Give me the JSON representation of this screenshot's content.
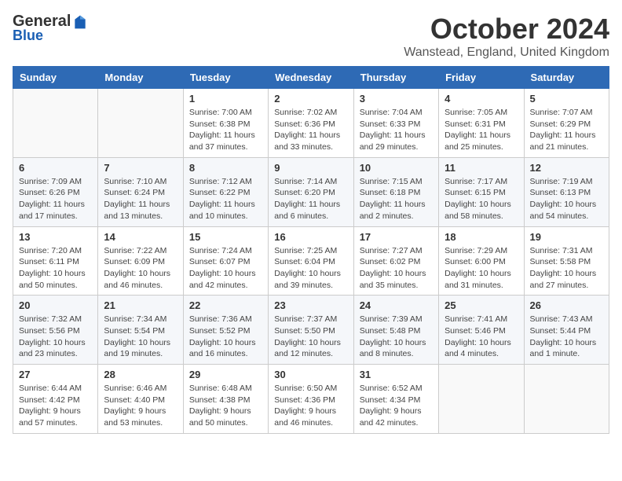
{
  "header": {
    "logo_general": "General",
    "logo_blue": "Blue",
    "month_title": "October 2024",
    "location": "Wanstead, England, United Kingdom"
  },
  "days_of_week": [
    "Sunday",
    "Monday",
    "Tuesday",
    "Wednesday",
    "Thursday",
    "Friday",
    "Saturday"
  ],
  "weeks": [
    [
      {
        "day": "",
        "info": ""
      },
      {
        "day": "",
        "info": ""
      },
      {
        "day": "1",
        "info": "Sunrise: 7:00 AM\nSunset: 6:38 PM\nDaylight: 11 hours\nand 37 minutes."
      },
      {
        "day": "2",
        "info": "Sunrise: 7:02 AM\nSunset: 6:36 PM\nDaylight: 11 hours\nand 33 minutes."
      },
      {
        "day": "3",
        "info": "Sunrise: 7:04 AM\nSunset: 6:33 PM\nDaylight: 11 hours\nand 29 minutes."
      },
      {
        "day": "4",
        "info": "Sunrise: 7:05 AM\nSunset: 6:31 PM\nDaylight: 11 hours\nand 25 minutes."
      },
      {
        "day": "5",
        "info": "Sunrise: 7:07 AM\nSunset: 6:29 PM\nDaylight: 11 hours\nand 21 minutes."
      }
    ],
    [
      {
        "day": "6",
        "info": "Sunrise: 7:09 AM\nSunset: 6:26 PM\nDaylight: 11 hours\nand 17 minutes."
      },
      {
        "day": "7",
        "info": "Sunrise: 7:10 AM\nSunset: 6:24 PM\nDaylight: 11 hours\nand 13 minutes."
      },
      {
        "day": "8",
        "info": "Sunrise: 7:12 AM\nSunset: 6:22 PM\nDaylight: 11 hours\nand 10 minutes."
      },
      {
        "day": "9",
        "info": "Sunrise: 7:14 AM\nSunset: 6:20 PM\nDaylight: 11 hours\nand 6 minutes."
      },
      {
        "day": "10",
        "info": "Sunrise: 7:15 AM\nSunset: 6:18 PM\nDaylight: 11 hours\nand 2 minutes."
      },
      {
        "day": "11",
        "info": "Sunrise: 7:17 AM\nSunset: 6:15 PM\nDaylight: 10 hours\nand 58 minutes."
      },
      {
        "day": "12",
        "info": "Sunrise: 7:19 AM\nSunset: 6:13 PM\nDaylight: 10 hours\nand 54 minutes."
      }
    ],
    [
      {
        "day": "13",
        "info": "Sunrise: 7:20 AM\nSunset: 6:11 PM\nDaylight: 10 hours\nand 50 minutes."
      },
      {
        "day": "14",
        "info": "Sunrise: 7:22 AM\nSunset: 6:09 PM\nDaylight: 10 hours\nand 46 minutes."
      },
      {
        "day": "15",
        "info": "Sunrise: 7:24 AM\nSunset: 6:07 PM\nDaylight: 10 hours\nand 42 minutes."
      },
      {
        "day": "16",
        "info": "Sunrise: 7:25 AM\nSunset: 6:04 PM\nDaylight: 10 hours\nand 39 minutes."
      },
      {
        "day": "17",
        "info": "Sunrise: 7:27 AM\nSunset: 6:02 PM\nDaylight: 10 hours\nand 35 minutes."
      },
      {
        "day": "18",
        "info": "Sunrise: 7:29 AM\nSunset: 6:00 PM\nDaylight: 10 hours\nand 31 minutes."
      },
      {
        "day": "19",
        "info": "Sunrise: 7:31 AM\nSunset: 5:58 PM\nDaylight: 10 hours\nand 27 minutes."
      }
    ],
    [
      {
        "day": "20",
        "info": "Sunrise: 7:32 AM\nSunset: 5:56 PM\nDaylight: 10 hours\nand 23 minutes."
      },
      {
        "day": "21",
        "info": "Sunrise: 7:34 AM\nSunset: 5:54 PM\nDaylight: 10 hours\nand 19 minutes."
      },
      {
        "day": "22",
        "info": "Sunrise: 7:36 AM\nSunset: 5:52 PM\nDaylight: 10 hours\nand 16 minutes."
      },
      {
        "day": "23",
        "info": "Sunrise: 7:37 AM\nSunset: 5:50 PM\nDaylight: 10 hours\nand 12 minutes."
      },
      {
        "day": "24",
        "info": "Sunrise: 7:39 AM\nSunset: 5:48 PM\nDaylight: 10 hours\nand 8 minutes."
      },
      {
        "day": "25",
        "info": "Sunrise: 7:41 AM\nSunset: 5:46 PM\nDaylight: 10 hours\nand 4 minutes."
      },
      {
        "day": "26",
        "info": "Sunrise: 7:43 AM\nSunset: 5:44 PM\nDaylight: 10 hours\nand 1 minute."
      }
    ],
    [
      {
        "day": "27",
        "info": "Sunrise: 6:44 AM\nSunset: 4:42 PM\nDaylight: 9 hours\nand 57 minutes."
      },
      {
        "day": "28",
        "info": "Sunrise: 6:46 AM\nSunset: 4:40 PM\nDaylight: 9 hours\nand 53 minutes."
      },
      {
        "day": "29",
        "info": "Sunrise: 6:48 AM\nSunset: 4:38 PM\nDaylight: 9 hours\nand 50 minutes."
      },
      {
        "day": "30",
        "info": "Sunrise: 6:50 AM\nSunset: 4:36 PM\nDaylight: 9 hours\nand 46 minutes."
      },
      {
        "day": "31",
        "info": "Sunrise: 6:52 AM\nSunset: 4:34 PM\nDaylight: 9 hours\nand 42 minutes."
      },
      {
        "day": "",
        "info": ""
      },
      {
        "day": "",
        "info": ""
      }
    ]
  ]
}
